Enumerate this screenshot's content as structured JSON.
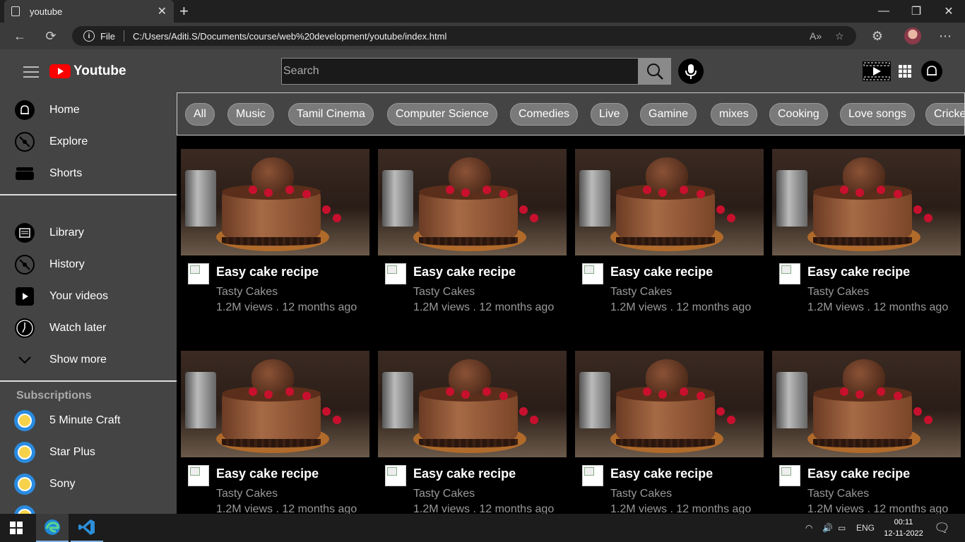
{
  "browser": {
    "tab_title": "youtube",
    "url_scheme_label": "File",
    "url": "C:/Users/Aditi.S/Documents/course/web%20development/youtube/index.html"
  },
  "header": {
    "logo_text": "Youtube",
    "search_placeholder": "Search"
  },
  "sidebar": {
    "main_items": [
      {
        "label": "Home",
        "icon": "bell-icon"
      },
      {
        "label": "Explore",
        "icon": "compass-icon"
      },
      {
        "label": "Shorts",
        "icon": "shorts-icon"
      }
    ],
    "library_items": [
      {
        "label": "Library",
        "icon": "library-icon"
      },
      {
        "label": "History",
        "icon": "history-icon"
      },
      {
        "label": "Your videos",
        "icon": "your-videos-icon"
      },
      {
        "label": "Watch later",
        "icon": "clock-icon"
      },
      {
        "label": "Show more",
        "icon": "chevron-down-icon"
      }
    ],
    "subscriptions_title": "Subscriptions",
    "subscriptions": [
      {
        "label": "5 Minute Craft"
      },
      {
        "label": "Star Plus"
      },
      {
        "label": "Sony"
      }
    ]
  },
  "chips": [
    "All",
    "Music",
    "Tamil Cinema",
    "Computer Science",
    "Comedies",
    "Live",
    "Gamine",
    "mixes",
    "Cooking",
    "Love songs",
    "Cricke"
  ],
  "videos": [
    {
      "title": "Easy cake recipe",
      "channel": "Tasty Cakes",
      "stats": "1.2M views . 12 months ago"
    },
    {
      "title": "Easy cake recipe",
      "channel": "Tasty Cakes",
      "stats": "1.2M views . 12 months ago"
    },
    {
      "title": "Easy cake recipe",
      "channel": "Tasty Cakes",
      "stats": "1.2M views . 12 months ago"
    },
    {
      "title": "Easy cake recipe",
      "channel": "Tasty Cakes",
      "stats": "1.2M views . 12 months ago"
    },
    {
      "title": "Easy cake recipe",
      "channel": "Tasty Cakes",
      "stats": "1.2M views . 12 months ago"
    },
    {
      "title": "Easy cake recipe",
      "channel": "Tasty Cakes",
      "stats": "1.2M views . 12 months ago"
    },
    {
      "title": "Easy cake recipe",
      "channel": "Tasty Cakes",
      "stats": "1.2M views . 12 months ago"
    },
    {
      "title": "Easy cake recipe",
      "channel": "Tasty Cakes",
      "stats": "1.2M views . 12 months ago"
    }
  ],
  "taskbar": {
    "language": "ENG",
    "time": "00:11",
    "date": "12-11-2022"
  },
  "colors": {
    "header_bg": "#444444",
    "page_bg": "#000000",
    "logo_red": "#ff0000",
    "chip_bg": "#7a7a7a"
  }
}
